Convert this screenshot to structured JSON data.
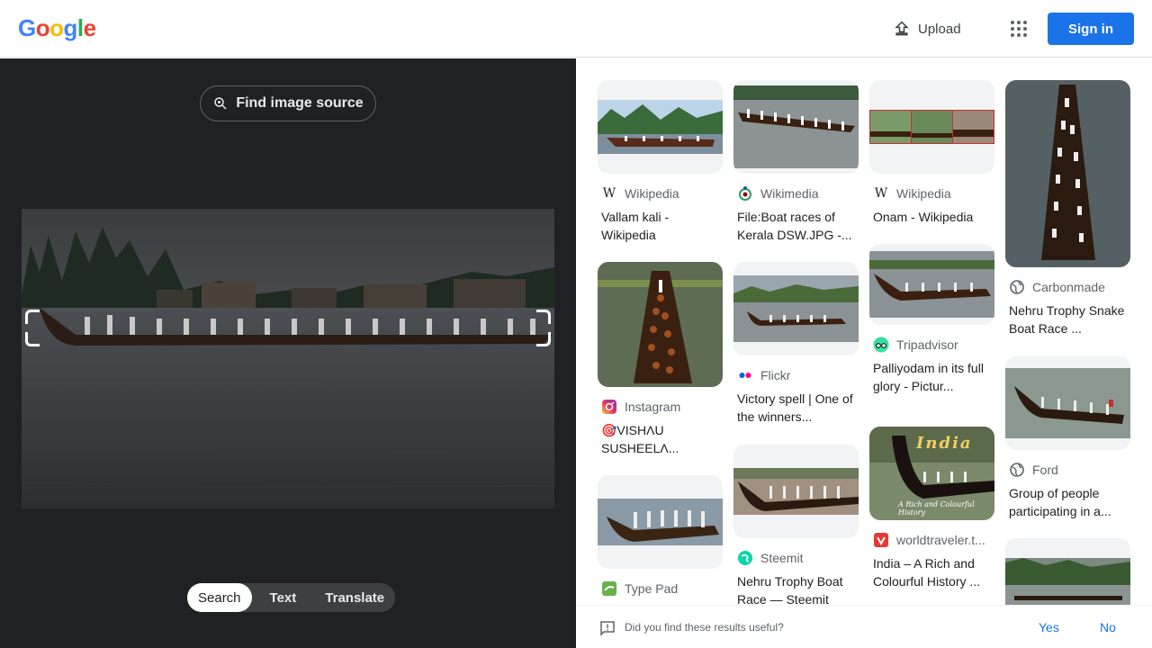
{
  "header": {
    "logo": [
      "G",
      "o",
      "o",
      "g",
      "l",
      "e"
    ],
    "logo_colors": [
      "#4285f4",
      "#ea4335",
      "#fbbc05",
      "#4285f4",
      "#34a853",
      "#ea4335"
    ],
    "upload_label": "Upload",
    "signin_label": "Sign in"
  },
  "left": {
    "find_source_label": "Find image source",
    "modes": [
      {
        "label": "Search",
        "active": true
      },
      {
        "label": "Text",
        "active": false
      },
      {
        "label": "Translate",
        "active": false
      }
    ]
  },
  "results": {
    "col1": [
      {
        "source": "Wikipedia",
        "icon": "wikipedia-icon",
        "title": "Vallam kali - Wikipedia"
      },
      {
        "source": "Instagram",
        "icon": "instagram-icon",
        "title": "🎯VISHɅU SUSHEELɅ..."
      },
      {
        "source": "Type Pad",
        "icon": "typepad-icon",
        "title": ""
      }
    ],
    "col2": [
      {
        "source": "Wikimedia",
        "icon": "wikimedia-icon",
        "title": "File:Boat races of Kerala DSW.JPG -..."
      },
      {
        "source": "Flickr",
        "icon": "flickr-icon",
        "title": "Victory spell | One of the winners..."
      },
      {
        "source": "Steemit",
        "icon": "steemit-icon",
        "title": "Nehru Trophy Boat Race — Steemit"
      }
    ],
    "col3": [
      {
        "source": "Wikipedia",
        "icon": "wikipedia-icon",
        "title": "Onam - Wikipedia"
      },
      {
        "source": "Tripadvisor",
        "icon": "tripadvisor-icon",
        "title": "Palliyodam in its full glory - Pictur..."
      },
      {
        "source": "worldtraveler.t...",
        "icon": "worldtraveler-icon",
        "title": "India – A Rich and Colourful History ...",
        "overlay": "India",
        "caption": "A Rich and Colourful History"
      }
    ],
    "col4": [
      {
        "source": "Carbonmade",
        "icon": "globe-icon",
        "title": "Nehru Trophy Snake Boat Race ..."
      },
      {
        "source": "Ford",
        "icon": "globe-icon",
        "title": "Group of people participating in a..."
      },
      {
        "source": "",
        "icon": "",
        "title": ""
      }
    ]
  },
  "footer": {
    "question": "Did you find these results useful?",
    "yes": "Yes",
    "no": "No"
  }
}
